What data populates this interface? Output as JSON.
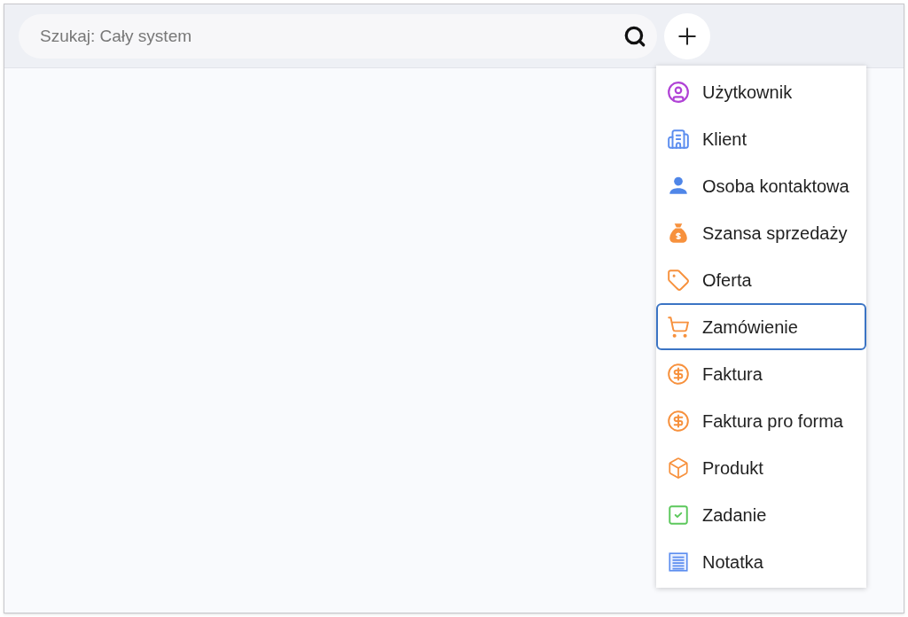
{
  "search": {
    "placeholder": "Szukaj: Cały system"
  },
  "add_menu": {
    "items": [
      {
        "kind": "user",
        "label": "Użytkownik",
        "selected": false
      },
      {
        "kind": "company",
        "label": "Klient",
        "selected": false
      },
      {
        "kind": "contact",
        "label": "Osoba kontaktowa",
        "selected": false
      },
      {
        "kind": "deal",
        "label": "Szansa sprzedaży",
        "selected": false
      },
      {
        "kind": "offer",
        "label": "Oferta",
        "selected": false
      },
      {
        "kind": "order",
        "label": "Zamówienie",
        "selected": true
      },
      {
        "kind": "invoice",
        "label": "Faktura",
        "selected": false
      },
      {
        "kind": "invoice",
        "label": "Faktura pro forma",
        "selected": false
      },
      {
        "kind": "product",
        "label": "Produkt",
        "selected": false
      },
      {
        "kind": "task",
        "label": "Zadanie",
        "selected": false
      },
      {
        "kind": "note",
        "label": "Notatka",
        "selected": false
      }
    ]
  }
}
